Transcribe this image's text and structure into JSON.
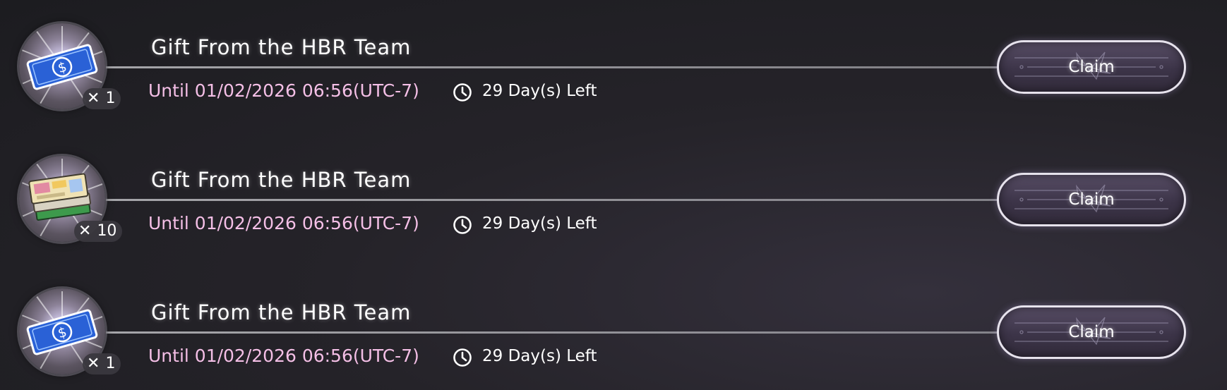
{
  "gifts": [
    {
      "title": "Gift From the HBR Team",
      "until": "Until 01/02/2026 06:56(UTC-7)",
      "days_left": "29 Day(s) Left",
      "quantity_mark": "✕",
      "quantity": "1",
      "item_icon": "ticket-icon",
      "claim_label": "Claim"
    },
    {
      "title": "Gift From the HBR Team",
      "until": "Until 01/02/2026 06:56(UTC-7)",
      "days_left": "29 Day(s) Left",
      "quantity_mark": "✕",
      "quantity": "10",
      "item_icon": "book-stack-icon",
      "claim_label": "Claim"
    },
    {
      "title": "Gift From the HBR Team",
      "until": "Until 01/02/2026 06:56(UTC-7)",
      "days_left": "29 Day(s) Left",
      "quantity_mark": "✕",
      "quantity": "1",
      "item_icon": "ticket-icon",
      "claim_label": "Claim"
    }
  ],
  "colors": {
    "title_text": "#ffffff",
    "until_text": "#f4bfe6",
    "button_fill": "#3c3448",
    "button_border": "#e6e2ec",
    "background": "#252329"
  }
}
